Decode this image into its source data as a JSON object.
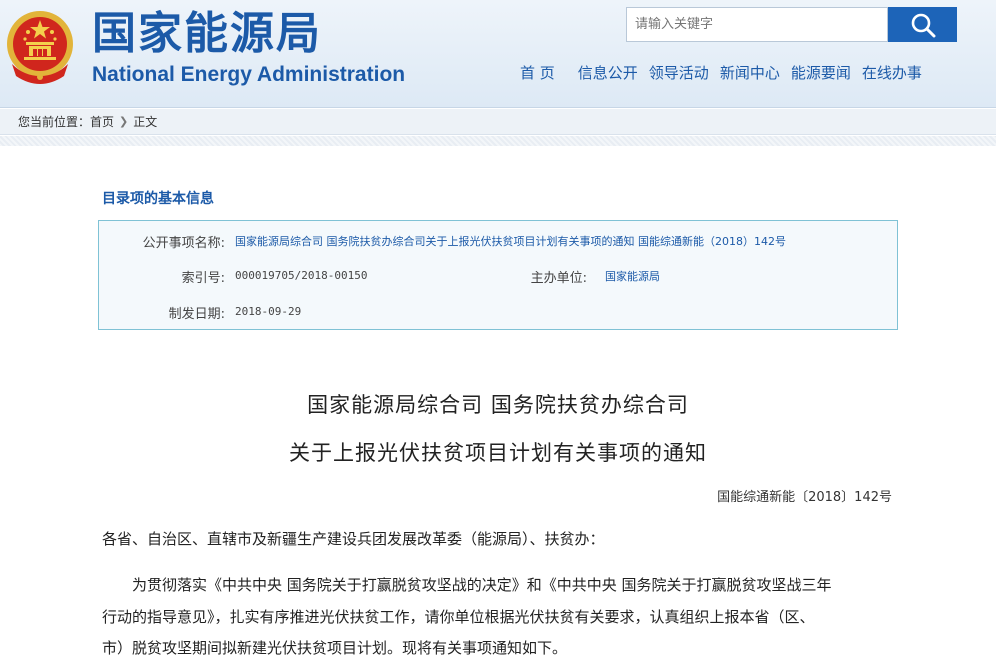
{
  "header": {
    "logo_cn": "国家能源局",
    "logo_en": "National Energy Administration",
    "search_placeholder": "请输入关键字"
  },
  "nav": [
    "首 页",
    "信息公开",
    "领导活动",
    "新闻中心",
    "能源要闻",
    "在线办事"
  ],
  "breadcrumb": {
    "prefix": "您当前位置：",
    "home": "首页",
    "current": "正文"
  },
  "info": {
    "section_title": "目录项的基本信息",
    "name_label": "公开事项名称:",
    "name_value": "国家能源局综合司 国务院扶贫办综合司关于上报光伏扶贫项目计划有关事项的通知 国能综通新能（2018）142号",
    "index_label": "索引号:",
    "index_value": "000019705/2018-00150",
    "org_label": "主办单位:",
    "org_value": "国家能源局",
    "date_label": "制发日期:",
    "date_value": "2018-09-29"
  },
  "article": {
    "title_line1": "国家能源局综合司  国务院扶贫办综合司",
    "title_line2": "关于上报光伏扶贫项目计划有关事项的通知",
    "doc_number": "国能综通新能〔2018〕142号",
    "salutation": "各省、自治区、直辖市及新疆生产建设兵团发展改革委（能源局）、扶贫办：",
    "body_line1": "为贯彻落实《中共中央 国务院关于打赢脱贫攻坚战的决定》和《中共中央 国务院关于打赢脱贫攻坚战三年",
    "body_line2": "行动的指导意见》，扎实有序推进光伏扶贫工作，请你单位根据光伏扶贫有关要求，认真组织上报本省（区、",
    "body_line3": "市）脱贫攻坚期间拟新建光伏扶贫项目计划。现将有关事项通知如下。"
  }
}
